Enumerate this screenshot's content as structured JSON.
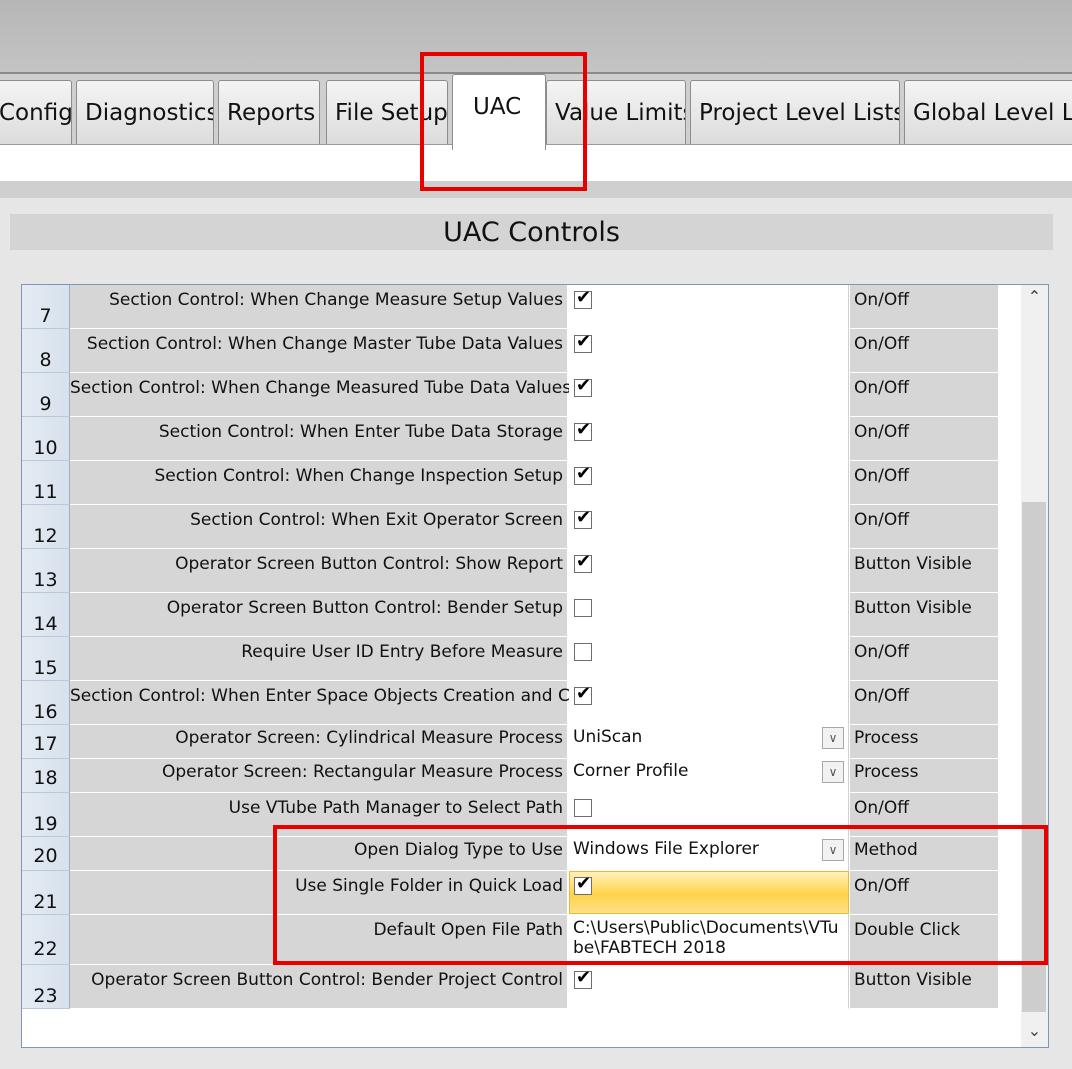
{
  "tabs": [
    "Config",
    "Diagnostics",
    "Reports",
    "File Setup",
    "UAC",
    "Value Limits",
    "Project Level Lists",
    "Global Level Lis"
  ],
  "active_tab": "UAC",
  "panel_title": "UAC Controls",
  "rows": [
    {
      "num": "7",
      "desc": "Section Control: When Change Measure Setup Values",
      "kind": "check",
      "checked": true,
      "type": "On/Off"
    },
    {
      "num": "8",
      "desc": "Section Control: When Change Master Tube Data Values",
      "kind": "check",
      "checked": true,
      "type": "On/Off"
    },
    {
      "num": "9",
      "desc": "Section Control: When Change Measured Tube Data Values",
      "kind": "check",
      "checked": true,
      "type": "On/Off"
    },
    {
      "num": "10",
      "desc": "Section Control: When Enter Tube Data Storage",
      "kind": "check",
      "checked": true,
      "type": "On/Off"
    },
    {
      "num": "11",
      "desc": "Section Control: When Change Inspection Setup",
      "kind": "check",
      "checked": true,
      "type": "On/Off"
    },
    {
      "num": "12",
      "desc": "Section Control: When Exit Operator Screen",
      "kind": "check",
      "checked": true,
      "type": "On/Off"
    },
    {
      "num": "13",
      "desc": "Operator Screen Button Control: Show Report",
      "kind": "check",
      "checked": true,
      "type": "Button Visible"
    },
    {
      "num": "14",
      "desc": "Operator Screen Button Control: Bender Setup",
      "kind": "check",
      "checked": false,
      "type": "Button Visible"
    },
    {
      "num": "15",
      "desc": "Require User ID Entry Before Measure",
      "kind": "check",
      "checked": false,
      "type": "On/Off"
    },
    {
      "num": "16",
      "desc": "Section Control: When Enter Space Objects Creation and Control",
      "kind": "check",
      "checked": true,
      "type": "On/Off"
    },
    {
      "num": "17",
      "desc": "Operator Screen: Cylindrical Measure Process",
      "kind": "dropdown",
      "value": "UniScan",
      "type": "Process"
    },
    {
      "num": "18",
      "desc": "Operator Screen: Rectangular Measure Process",
      "kind": "dropdown",
      "value": "Corner Profile",
      "type": "Process"
    },
    {
      "num": "19",
      "desc": "Use VTube Path Manager to Select Path",
      "kind": "check",
      "checked": false,
      "type": "On/Off"
    },
    {
      "num": "20",
      "desc": "Open Dialog Type to Use",
      "kind": "dropdown",
      "value": "Windows File Explorer",
      "type": "Method"
    },
    {
      "num": "21",
      "desc": "Use Single Folder in Quick Load",
      "kind": "check",
      "checked": true,
      "highlight": true,
      "type": "On/Off"
    },
    {
      "num": "22",
      "desc": "Default Open File Path",
      "kind": "text",
      "value": "C:\\Users\\Public\\Documents\\VTube\\FABTECH 2018",
      "type": "Double Click"
    },
    {
      "num": "23",
      "desc": "Operator Screen Button Control: Bender Project Control",
      "kind": "check",
      "checked": true,
      "type": "Button Visible"
    }
  ],
  "scroll_up_icon": "chevron-up-icon",
  "scroll_down_icon": "chevron-down-icon",
  "highlight_color": "#e60000"
}
